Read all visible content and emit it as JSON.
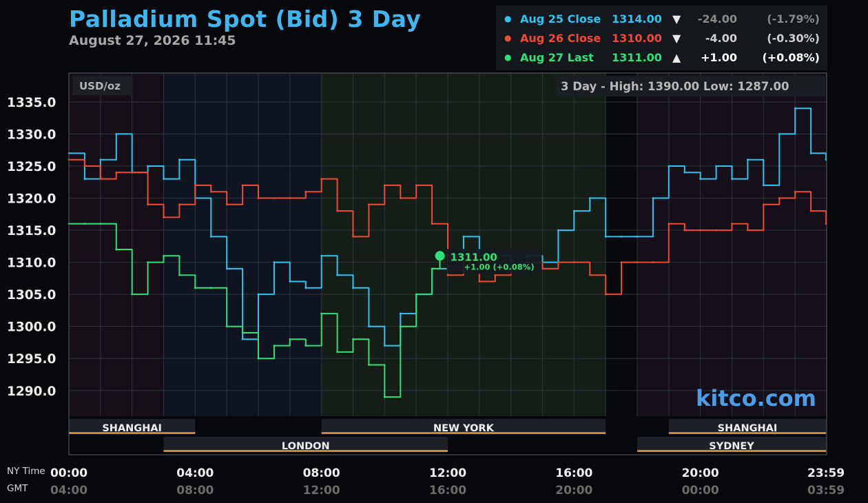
{
  "header": {
    "title": "Palladium Spot (Bid) 3 Day",
    "subtitle": "August 27, 2026 11:45"
  },
  "legend": [
    {
      "name": "Aug 25 Close",
      "value": "1314.00",
      "arrow": "▼",
      "change": "-24.00",
      "pct": "(-1.79%)",
      "color": "#2ec4ef",
      "text_color": "#2ec4ef",
      "change_color": "#8a8a8a"
    },
    {
      "name": "Aug 26 Close",
      "value": "1310.00",
      "arrow": "▼",
      "change": "-4.00",
      "pct": "(-0.30%)",
      "color": "#ef4a35",
      "text_color": "#ef4a35",
      "change_color": "#d0d0d0"
    },
    {
      "name": "Aug 27 Last",
      "value": "1311.00",
      "arrow": "▲",
      "change": "+1.00",
      "pct": "(+0.08%)",
      "color": "#2fe07a",
      "text_color": "#2fe07a",
      "change_color": "#ffffff"
    }
  ],
  "plot": {
    "unit_label": "USD/oz",
    "high_low": "3 Day - High: 1390.00  Low: 1287.00",
    "brand": "kitco.com",
    "last_value_label": "1311.00",
    "last_change_label": "+1.00 (+0.08%)"
  },
  "axis": {
    "tz_ny": "NY Time",
    "tz_gmt": "GMT"
  },
  "sessions": [
    {
      "name": "SHANGHAI",
      "row": 0,
      "start": 0,
      "end": 4
    },
    {
      "name": "NEW YORK",
      "row": 0,
      "start": 8,
      "end": 17
    },
    {
      "name": "SHANGHAI",
      "row": 0,
      "start": 19,
      "end": 23.98
    },
    {
      "name": "LONDON",
      "row": 1,
      "start": 3,
      "end": 12
    },
    {
      "name": "SYDNEY",
      "row": 1,
      "start": 18,
      "end": 23.98
    }
  ],
  "colors": {
    "aug25": "#2ec4ef",
    "aug26": "#ef4a35",
    "aug27": "#2fe07a",
    "session_bar": "#c88a30"
  },
  "chart_data": {
    "type": "line",
    "title": "Palladium Spot (Bid) 3 Day",
    "ylabel": "USD/oz",
    "ylim": [
      1286.0,
      1339.5
    ],
    "xlim_hours": [
      0,
      24
    ],
    "y_ticks": [
      "1335.0",
      "1330.0",
      "1325.0",
      "1320.0",
      "1315.0",
      "1310.0",
      "1305.0",
      "1300.0",
      "1295.0",
      "1290.0"
    ],
    "x_ticks_ny": [
      "00:00",
      "04:00",
      "08:00",
      "12:00",
      "16:00",
      "20:00",
      "23:59"
    ],
    "x_ticks_gmt": [
      "04:00",
      "08:00",
      "12:00",
      "16:00",
      "20:00",
      "00:00",
      "03:59"
    ],
    "grid": true,
    "series": [
      {
        "name": "Aug 25 Close",
        "x": [
          0,
          0.5,
          1.0,
          1.5,
          2.0,
          2.5,
          3.0,
          3.5,
          4.0,
          4.5,
          5.0,
          5.5,
          6.0,
          6.5,
          7.0,
          7.5,
          8.0,
          8.5,
          9.0,
          9.5,
          10.0,
          10.5,
          11.0,
          11.5,
          12.0,
          12.5,
          13.0,
          13.5,
          14.0,
          14.5,
          15.0,
          15.5,
          16.0,
          16.5,
          17.0,
          17.5,
          18.0,
          18.5,
          19.0,
          19.5,
          20.0,
          20.5,
          21.0,
          21.5,
          22.0,
          22.5,
          23.0,
          23.5,
          23.98
        ],
        "values": [
          1327,
          1323,
          1326,
          1330,
          1324,
          1325,
          1323,
          1326,
          1320,
          1314,
          1309,
          1298,
          1305,
          1310,
          1307,
          1306,
          1311,
          1308,
          1306,
          1300,
          1297,
          1302,
          1305,
          1309,
          1311,
          1314,
          1311,
          1311,
          1309,
          1311,
          1310,
          1315,
          1318,
          1320,
          1314,
          1314,
          1314,
          1320,
          1325,
          1324,
          1323,
          1325,
          1323,
          1326,
          1322,
          1330,
          1334,
          1327,
          1326
        ]
      },
      {
        "name": "Aug 26 Close",
        "x": [
          0,
          0.5,
          1.0,
          1.5,
          2.0,
          2.5,
          3.0,
          3.5,
          4.0,
          4.5,
          5.0,
          5.5,
          6.0,
          6.5,
          7.0,
          7.5,
          8.0,
          8.5,
          9.0,
          9.5,
          10.0,
          10.5,
          11.0,
          11.5,
          12.0,
          12.5,
          13.0,
          13.5,
          14.0,
          14.5,
          15.0,
          15.5,
          16.0,
          16.5,
          17.0,
          17.5,
          18.0,
          18.5,
          19.0,
          19.5,
          20.0,
          20.5,
          21.0,
          21.5,
          22.0,
          22.5,
          23.0,
          23.5,
          23.98
        ],
        "values": [
          1326,
          1325,
          1323,
          1324,
          1324,
          1319,
          1317,
          1319,
          1322,
          1321,
          1319,
          1322,
          1320,
          1320,
          1320,
          1321,
          1323,
          1318,
          1314,
          1319,
          1322,
          1320,
          1322,
          1316,
          1308,
          1311,
          1307,
          1308,
          1309,
          1310,
          1309,
          1310,
          1310,
          1308,
          1305,
          1310,
          1310,
          1310,
          1316,
          1315,
          1315,
          1315,
          1316,
          1315,
          1319,
          1320,
          1321,
          1318,
          1316
        ]
      },
      {
        "name": "Aug 27 Last",
        "x": [
          0,
          0.5,
          1.0,
          1.5,
          2.0,
          2.5,
          3.0,
          3.5,
          4.0,
          4.5,
          5.0,
          5.5,
          6.0,
          6.5,
          7.0,
          7.5,
          8.0,
          8.5,
          9.0,
          9.5,
          10.0,
          10.5,
          11.0,
          11.5,
          11.75
        ],
        "values": [
          1316,
          1316,
          1316,
          1312,
          1305,
          1310,
          1311,
          1308,
          1306,
          1306,
          1300,
          1299,
          1295,
          1297,
          1298,
          1297,
          1302,
          1296,
          1298,
          1294,
          1289,
          1300,
          1305,
          1309,
          1311
        ]
      }
    ]
  }
}
